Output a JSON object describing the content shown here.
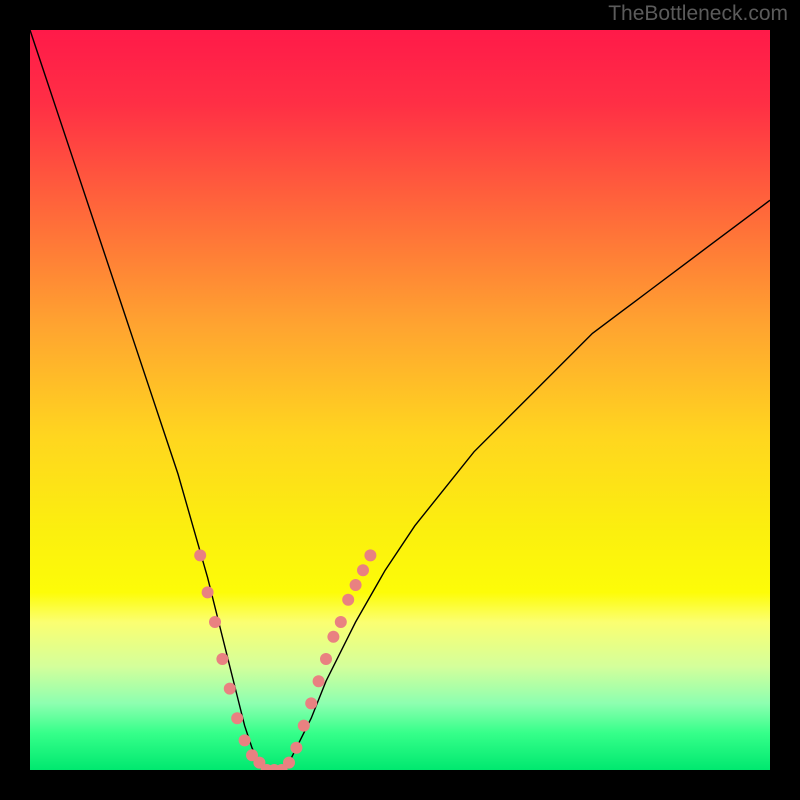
{
  "watermark": "TheBottleneck.com",
  "chart_data": {
    "type": "line",
    "title": "",
    "xlabel": "",
    "ylabel": "",
    "xlim": [
      0,
      100
    ],
    "ylim": [
      0,
      100
    ],
    "background_gradient": {
      "stops": [
        {
          "offset": 0.0,
          "color": "#ff1a49"
        },
        {
          "offset": 0.1,
          "color": "#ff2f45"
        },
        {
          "offset": 0.25,
          "color": "#ff6a3a"
        },
        {
          "offset": 0.4,
          "color": "#ffa430"
        },
        {
          "offset": 0.55,
          "color": "#ffd61f"
        },
        {
          "offset": 0.68,
          "color": "#fbf00e"
        },
        {
          "offset": 0.76,
          "color": "#fdfc08"
        },
        {
          "offset": 0.8,
          "color": "#fbff71"
        },
        {
          "offset": 0.86,
          "color": "#d4ff9b"
        },
        {
          "offset": 0.91,
          "color": "#8dffb0"
        },
        {
          "offset": 0.95,
          "color": "#36ff8a"
        },
        {
          "offset": 1.0,
          "color": "#00e86f"
        }
      ]
    },
    "series": [
      {
        "name": "bottleneck-curve",
        "color": "#000000",
        "stroke_width": 1.4,
        "x": [
          0,
          2,
          4,
          6,
          8,
          10,
          12,
          14,
          16,
          18,
          20,
          22,
          24,
          26,
          27,
          28,
          29,
          30,
          31,
          32,
          33,
          34,
          35,
          36,
          38,
          40,
          44,
          48,
          52,
          56,
          60,
          64,
          68,
          72,
          76,
          80,
          84,
          88,
          92,
          96,
          100
        ],
        "y": [
          100,
          94,
          88,
          82,
          76,
          70,
          64,
          58,
          52,
          46,
          40,
          33,
          26,
          18,
          14,
          10,
          6,
          3,
          1,
          0,
          0,
          0,
          1,
          3,
          7,
          12,
          20,
          27,
          33,
          38,
          43,
          47,
          51,
          55,
          59,
          62,
          65,
          68,
          71,
          74,
          77
        ]
      }
    ],
    "dot_series": {
      "name": "highlighted-points",
      "color": "#e98181",
      "radius": 6,
      "points": [
        {
          "x": 23,
          "y": 29
        },
        {
          "x": 24,
          "y": 24
        },
        {
          "x": 25,
          "y": 20
        },
        {
          "x": 26,
          "y": 15
        },
        {
          "x": 27,
          "y": 11
        },
        {
          "x": 28,
          "y": 7
        },
        {
          "x": 29,
          "y": 4
        },
        {
          "x": 30,
          "y": 2
        },
        {
          "x": 31,
          "y": 1
        },
        {
          "x": 32,
          "y": 0
        },
        {
          "x": 33,
          "y": 0
        },
        {
          "x": 34,
          "y": 0
        },
        {
          "x": 35,
          "y": 1
        },
        {
          "x": 36,
          "y": 3
        },
        {
          "x": 37,
          "y": 6
        },
        {
          "x": 38,
          "y": 9
        },
        {
          "x": 39,
          "y": 12
        },
        {
          "x": 40,
          "y": 15
        },
        {
          "x": 41,
          "y": 18
        },
        {
          "x": 42,
          "y": 20
        },
        {
          "x": 43,
          "y": 23
        },
        {
          "x": 44,
          "y": 25
        },
        {
          "x": 45,
          "y": 27
        },
        {
          "x": 46,
          "y": 29
        }
      ]
    }
  }
}
